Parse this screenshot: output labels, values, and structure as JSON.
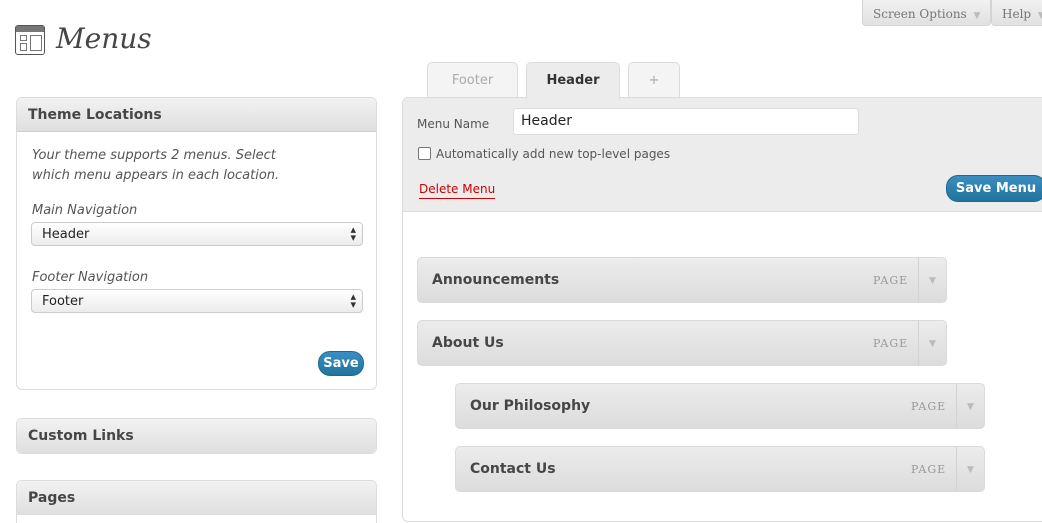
{
  "top_bar": {
    "screen_options_label": "Screen Options",
    "help_label": "Help",
    "arrow_glyph": "▼"
  },
  "page": {
    "title": "Menus",
    "icon": "menus-icon"
  },
  "theme_locations": {
    "title": "Theme Locations",
    "description_line1": "Your theme supports 2 menus. Select",
    "description_line2": "which menu appears in each location.",
    "main_nav_label": "Main Navigation",
    "main_nav_value": "Header",
    "footer_nav_label": "Footer Navigation",
    "footer_nav_value": "Footer",
    "save_label": "Save"
  },
  "custom_links": {
    "title": "Custom Links"
  },
  "pages_panel": {
    "title": "Pages"
  },
  "tabs": [
    {
      "label": "Footer",
      "active": false
    },
    {
      "label": "Header",
      "active": true
    },
    {
      "label": "+",
      "active": false
    }
  ],
  "editor": {
    "menu_name_label": "Menu Name",
    "menu_name_value": "Header",
    "auto_add_label": "Automatically add new top-level pages",
    "auto_add_checked": false,
    "delete_label": "Delete Menu",
    "save_menu_label": "Save Menu"
  },
  "menu_items": [
    {
      "title": "Announcements",
      "type": "PAGE",
      "depth": 0
    },
    {
      "title": "About Us",
      "type": "PAGE",
      "depth": 0
    },
    {
      "title": "Our Philosophy",
      "type": "PAGE",
      "depth": 1
    },
    {
      "title": "Contact Us",
      "type": "PAGE",
      "depth": 1
    }
  ],
  "colors": {
    "primary_button": "#21759b",
    "delete_link": "#cc0000",
    "panel_header": "#e6e6e6"
  }
}
